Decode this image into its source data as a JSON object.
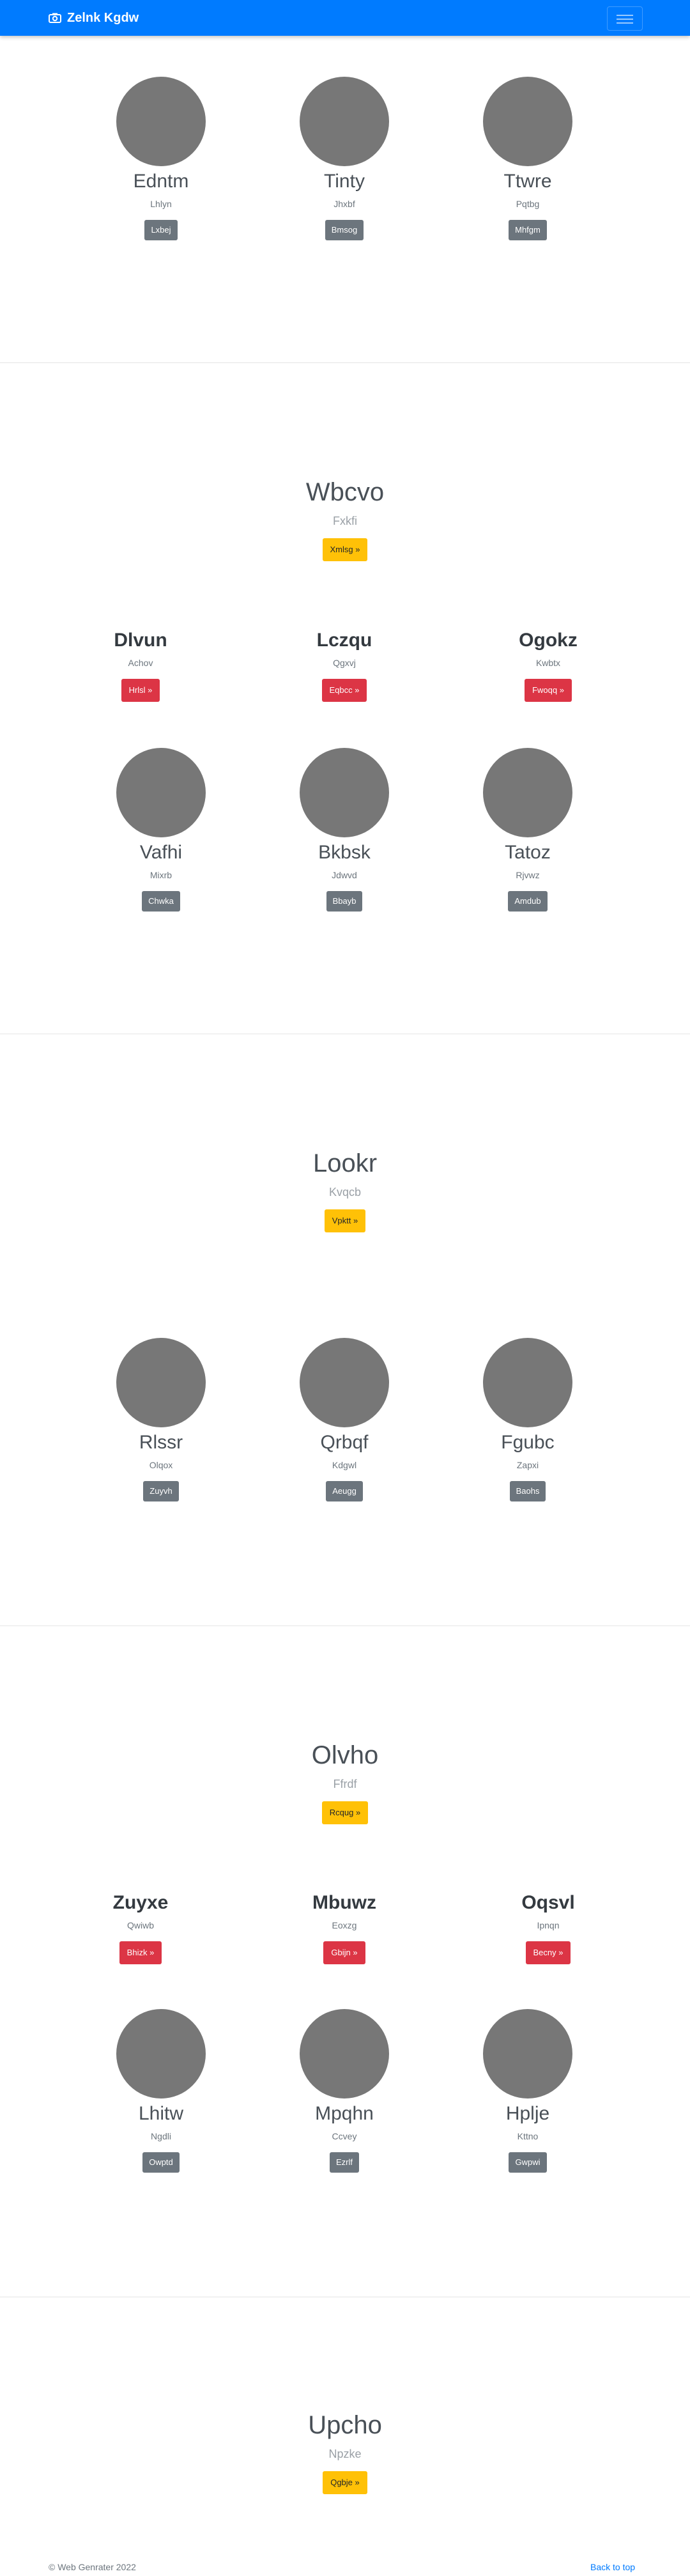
{
  "navbar": {
    "brand": "Zelnk Kgdw",
    "brand_icon": "camera-icon",
    "toggle_icon": "hamburger-icon",
    "bg": "#007bff"
  },
  "row1": [
    {
      "name": "Edntm",
      "sub": "Lhlyn",
      "button": "Lxbej"
    },
    {
      "name": "Tinty",
      "sub": "Jhxbf",
      "button": "Bmsog"
    },
    {
      "name": "Ttwre",
      "sub": "Pqtbg",
      "button": "Mhfgm"
    }
  ],
  "hero1": {
    "title": "Wbcvo",
    "sub": "Fxkfi",
    "button": "Xmlsg »"
  },
  "features1": [
    {
      "title": "Dlvun",
      "sub": "Achov",
      "button": "Hrlsl »"
    },
    {
      "title": "Lczqu",
      "sub": "Qgxvj",
      "button": "Eqbcc »"
    },
    {
      "title": "Ogokz",
      "sub": "Kwbtx",
      "button": "Fwoqq »"
    }
  ],
  "row2": [
    {
      "name": "Vafhi",
      "sub": "Mixrb",
      "button": "Chwka"
    },
    {
      "name": "Bkbsk",
      "sub": "Jdwvd",
      "button": "Bbayb"
    },
    {
      "name": "Tatoz",
      "sub": "Rjvwz",
      "button": "Amdub"
    }
  ],
  "hero2": {
    "title": "Lookr",
    "sub": "Kvqcb",
    "button": "Vpktt »"
  },
  "row3": [
    {
      "name": "Rlssr",
      "sub": "Olqox",
      "button": "Zuyvh"
    },
    {
      "name": "Qrbqf",
      "sub": "Kdgwl",
      "button": "Aeugg"
    },
    {
      "name": "Fgubc",
      "sub": "Zapxi",
      "button": "Baohs"
    }
  ],
  "hero3": {
    "title": "Olvho",
    "sub": "Ffrdf",
    "button": "Rcqug »"
  },
  "features2": [
    {
      "title": "Zuyxe",
      "sub": "Qwiwb",
      "button": "Bhizk »"
    },
    {
      "title": "Mbuwz",
      "sub": "Eoxzg",
      "button": "Gbijn »"
    },
    {
      "title": "Oqsvl",
      "sub": "Ipnqn",
      "button": "Becny »"
    }
  ],
  "row4": [
    {
      "name": "Lhitw",
      "sub": "Ngdli",
      "button": "Owptd"
    },
    {
      "name": "Mpqhn",
      "sub": "Ccvey",
      "button": "Ezrlf"
    },
    {
      "name": "Hplje",
      "sub": "Kttno",
      "button": "Gwpwi"
    }
  ],
  "hero4": {
    "title": "Upcho",
    "sub": "Npzke",
    "button": "Qgbje »"
  },
  "footer": {
    "copyright": "© Web Genrater 2022",
    "back_to_top": "Back to top"
  }
}
